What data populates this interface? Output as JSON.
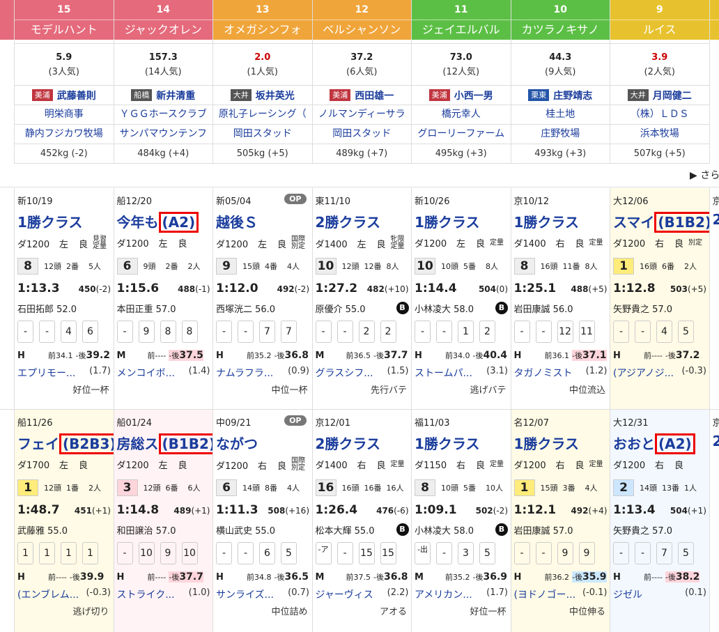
{
  "horses": [
    {
      "num": "15",
      "name": "モデルハント",
      "color": "#e56a7b",
      "odds": "5.9",
      "fav": "(3人気)",
      "top": false,
      "belong": "美浦",
      "bcolor": "#c0353f",
      "jockey": "武藤善則",
      "owner": "明栄商事",
      "breeder": "静内フジカワ牧場",
      "weight": "452kg (-2)"
    },
    {
      "num": "14",
      "name": "ジャックオレン",
      "color": "#e56a7b",
      "odds": "157.3",
      "fav": "(14人気)",
      "top": false,
      "belong": "船橋",
      "bcolor": "#555",
      "jockey": "新井清重",
      "owner": "ＹＧＧホースクラブ",
      "breeder": "サンパマウンテンフ",
      "weight": "484kg (+4)"
    },
    {
      "num": "13",
      "name": "オメガシンフォ",
      "color": "#f0a53a",
      "odds": "2.0",
      "fav": "(1人気)",
      "top": true,
      "belong": "大井",
      "bcolor": "#555",
      "jockey": "坂井英光",
      "owner": "原礼子レーシング（",
      "breeder": "岡田スタッド",
      "weight": "505kg (+5)"
    },
    {
      "num": "12",
      "name": "ベルシャンソン",
      "color": "#f0a53a",
      "odds": "37.2",
      "fav": "(6人気)",
      "top": false,
      "belong": "美浦",
      "bcolor": "#c0353f",
      "jockey": "西田雄一",
      "owner": "ノルマンディーサラ",
      "breeder": "岡田スタッド",
      "weight": "489kg (+7)"
    },
    {
      "num": "11",
      "name": "ジェイエルバル",
      "color": "#5cbf45",
      "odds": "73.0",
      "fav": "(12人気)",
      "top": false,
      "belong": "美浦",
      "bcolor": "#c0353f",
      "jockey": "小西一男",
      "owner": "橋元幸人",
      "breeder": "グローリーファーム",
      "weight": "495kg (+3)"
    },
    {
      "num": "10",
      "name": "カツラノキサノ",
      "color": "#5cbf45",
      "odds": "44.3",
      "fav": "(9人気)",
      "top": false,
      "belong": "栗東",
      "bcolor": "#2455a8",
      "jockey": "庄野靖志",
      "owner": "桂土地",
      "breeder": "庄野牧場",
      "weight": "493kg (+3)"
    },
    {
      "num": "9",
      "name": "ルイス",
      "color": "#e8c22e",
      "odds": "3.9",
      "fav": "(2人気)",
      "top": true,
      "belong": "大井",
      "bcolor": "#555",
      "jockey": "月岡健二",
      "owner": "（株）ＬＤＳ",
      "breeder": "浜本牧場",
      "weight": "507kg (+5)"
    }
  ],
  "more_link": "▶ さら",
  "race1": [
    {
      "bg": "",
      "date": "新10/19",
      "op": "",
      "pre": "",
      "tag": "",
      "title": "1勝クラス",
      "dist": "ダ1200",
      "dir": "左",
      "track": "良",
      "note": "見習\n定量",
      "rank": "8",
      "rcls": "",
      "heads": "12頭",
      "gate": "2番",
      "pop": "5人",
      "time": "1:13.3",
      "bw": "450",
      "bwd": "(-2)",
      "jockey": "石田拓郎 52.0",
      "blinker": false,
      "pass": [
        "-",
        "-",
        "4",
        "6"
      ],
      "pace": "H",
      "f3": "前34.1",
      "l3": "39.2",
      "l3c": "",
      "winner": "エプリモー...",
      "diff": "(1.7)",
      "comment": "好位一杯"
    },
    {
      "bg": "",
      "date": "船12/20",
      "op": "",
      "pre": "今年も",
      "tag": "(A2)",
      "title": "",
      "dist": "ダ1200",
      "dir": "左",
      "track": "良",
      "note": "",
      "rank": "6",
      "rcls": "",
      "heads": "9頭",
      "gate": "2番",
      "pop": "2人",
      "time": "1:15.6",
      "bw": "488",
      "bwd": "(-1)",
      "jockey": "本田正重 57.0",
      "blinker": false,
      "pass": [
        "-",
        "9",
        "8",
        "8"
      ],
      "pace": "M",
      "f3": "前----",
      "l3": "37.5",
      "l3c": "hp",
      "winner": "メンコイボ...",
      "diff": "(1.4)",
      "comment": ""
    },
    {
      "bg": "",
      "date": "新05/04",
      "op": "OP",
      "pre": "",
      "tag": "",
      "title": "越後Ｓ",
      "dist": "ダ1200",
      "dir": "左",
      "track": "良",
      "note": "国際\n別定",
      "rank": "9",
      "rcls": "",
      "heads": "15頭",
      "gate": "4番",
      "pop": "4人",
      "time": "1:12.0",
      "bw": "492",
      "bwd": "(-2)",
      "jockey": "西塚洸二 56.0",
      "blinker": false,
      "pass": [
        "-",
        "-",
        "7",
        "7"
      ],
      "pace": "H",
      "f3": "前35.2",
      "l3": "36.8",
      "l3c": "",
      "winner": "ナムラフラ...",
      "diff": "(0.9)",
      "comment": "中位一杯"
    },
    {
      "bg": "",
      "date": "東11/10",
      "op": "",
      "pre": "",
      "tag": "",
      "title": "2勝クラス",
      "dist": "ダ1400",
      "dir": "左",
      "track": "良",
      "note": "牝限\n定量",
      "rank": "10",
      "rcls": "",
      "heads": "12頭",
      "gate": "12番",
      "pop": "8人",
      "time": "1:27.2",
      "bw": "482",
      "bwd": "(+10)",
      "jockey": "原優介 55.0",
      "blinker": true,
      "pass": [
        "-",
        "-",
        "2",
        "2"
      ],
      "pace": "M",
      "f3": "前36.5",
      "l3": "37.7",
      "l3c": "",
      "winner": "グラスシフ...",
      "diff": "(1.5)",
      "comment": "先行バテ"
    },
    {
      "bg": "",
      "date": "新10/26",
      "op": "",
      "pre": "",
      "tag": "",
      "title": "1勝クラス",
      "dist": "ダ1200",
      "dir": "左",
      "track": "良",
      "note": "定量",
      "rank": "10",
      "rcls": "",
      "heads": "10頭",
      "gate": "5番",
      "pop": "8人",
      "time": "1:14.4",
      "bw": "504",
      "bwd": "(0)",
      "jockey": "小林凌大 58.0",
      "blinker": true,
      "pass": [
        "-",
        "-",
        "1",
        "2"
      ],
      "pace": "H",
      "f3": "前34.0",
      "l3": "40.4",
      "l3c": "",
      "winner": "ストームパ...",
      "diff": "(3.1)",
      "comment": "逃げバテ"
    },
    {
      "bg": "",
      "date": "京10/12",
      "op": "",
      "pre": "",
      "tag": "",
      "title": "1勝クラス",
      "dist": "ダ1400",
      "dir": "右",
      "track": "良",
      "note": "定量",
      "rank": "8",
      "rcls": "",
      "heads": "16頭",
      "gate": "11番",
      "pop": "8人",
      "time": "1:25.1",
      "bw": "488",
      "bwd": "(+5)",
      "jockey": "岩田康誠 56.0",
      "blinker": false,
      "pass": [
        "-",
        "-",
        "12",
        "11"
      ],
      "pace": "H",
      "f3": "前36.1",
      "l3": "37.1",
      "l3c": "hp",
      "winner": "タガノミスト",
      "diff": "(1.2)",
      "comment": "中位流込"
    },
    {
      "bg": "hl",
      "date": "大12/06",
      "op": "",
      "pre": "スマイ",
      "tag": "(B1B2)",
      "title": "",
      "dist": "ダ1200",
      "dir": "右",
      "track": "良",
      "note": "別定",
      "rank": "1",
      "rcls": "w",
      "heads": "16頭",
      "gate": "6番",
      "pop": "2人",
      "time": "1:12.8",
      "bw": "503",
      "bwd": "(+5)",
      "jockey": "矢野貴之 57.0",
      "blinker": false,
      "pass": [
        "-",
        "-",
        "4",
        "5"
      ],
      "pace": "H",
      "f3": "前----",
      "l3": "37.2",
      "l3c": "",
      "winner": "(アジアノジ...",
      "diff": "(-0.3)",
      "comment": ""
    }
  ],
  "race2": [
    {
      "bg": "hl",
      "date": "船11/26",
      "op": "",
      "pre": "フェイ",
      "tag": "(B2B3)",
      "title": "",
      "dist": "ダ1700",
      "dir": "左",
      "track": "良",
      "note": "",
      "rank": "1",
      "rcls": "w",
      "heads": "12頭",
      "gate": "1番",
      "pop": "2人",
      "time": "1:48.7",
      "bw": "451",
      "bwd": "(+1)",
      "jockey": "武藤雅 55.0",
      "blinker": false,
      "pass": [
        "1",
        "1",
        "1",
        "1"
      ],
      "pace": "H",
      "f3": "前----",
      "l3": "39.9",
      "l3c": "",
      "winner": "(エンブレム...",
      "diff": "(-0.3)",
      "comment": "逃げ切り"
    },
    {
      "bg": "pink",
      "date": "船01/24",
      "op": "",
      "pre": "房総ス",
      "tag": "(B1B2)",
      "title": "",
      "dist": "ダ1200",
      "dir": "左",
      "track": "良",
      "note": "",
      "rank": "3",
      "rcls": "s",
      "heads": "12頭",
      "gate": "6番",
      "pop": "6人",
      "time": "1:14.8",
      "bw": "489",
      "bwd": "(+1)",
      "jockey": "和田譲治 57.0",
      "blinker": false,
      "pass": [
        "-",
        "10",
        "9",
        "10"
      ],
      "pace": "H",
      "f3": "前----",
      "l3": "37.7",
      "l3c": "hp",
      "winner": "ストライク...",
      "diff": "(1.0)",
      "comment": ""
    },
    {
      "bg": "",
      "date": "中09/21",
      "op": "OP",
      "pre": "",
      "tag": "",
      "title": "ながつ",
      "dist": "ダ1200",
      "dir": "右",
      "track": "良",
      "note": "国際\n別定",
      "rank": "6",
      "rcls": "",
      "heads": "14頭",
      "gate": "8番",
      "pop": "4人",
      "time": "1:11.3",
      "bw": "508",
      "bwd": "(+16)",
      "jockey": "横山武史 55.0",
      "blinker": false,
      "pass": [
        "-",
        "-",
        "6",
        "5"
      ],
      "pace": "H",
      "f3": "前34.8",
      "l3": "36.5",
      "l3c": "",
      "winner": "サンライズ...",
      "diff": "(0.7)",
      "comment": "中位詰め"
    },
    {
      "bg": "",
      "date": "京12/01",
      "op": "",
      "pre": "",
      "tag": "",
      "title": "2勝クラス",
      "dist": "ダ1400",
      "dir": "右",
      "track": "良",
      "note": "定量",
      "rank": "16",
      "rcls": "",
      "heads": "16頭",
      "gate": "16番",
      "pop": "16人",
      "time": "1:26.4",
      "bw": "476",
      "bwd": "(-6)",
      "jockey": "松本大輝 55.0",
      "blinker": true,
      "pass": [
        "-ア",
        "-",
        "15",
        "15"
      ],
      "pace": "M",
      "f3": "前37.5",
      "l3": "36.8",
      "l3c": "",
      "winner": "ジャーヴィス",
      "diff": "(2.2)",
      "comment": "アオる"
    },
    {
      "bg": "",
      "date": "福11/03",
      "op": "",
      "pre": "",
      "tag": "",
      "title": "1勝クラス",
      "dist": "ダ1150",
      "dir": "右",
      "track": "良",
      "note": "定量",
      "rank": "8",
      "rcls": "",
      "heads": "10頭",
      "gate": "5番",
      "pop": "10人",
      "time": "1:09.1",
      "bw": "502",
      "bwd": "(-2)",
      "jockey": "小林凌大 58.0",
      "blinker": true,
      "pass": [
        "-出",
        "-",
        "3",
        "5"
      ],
      "pace": "M",
      "f3": "前35.2",
      "l3": "36.9",
      "l3c": "",
      "winner": "アメリカン...",
      "diff": "(1.7)",
      "comment": "好位一杯"
    },
    {
      "bg": "hl",
      "date": "名12/07",
      "op": "",
      "pre": "",
      "tag": "",
      "title": "1勝クラス",
      "dist": "ダ1200",
      "dir": "右",
      "track": "良",
      "note": "定量",
      "rank": "1",
      "rcls": "w",
      "heads": "15頭",
      "gate": "3番",
      "pop": "4人",
      "time": "1:12.1",
      "bw": "492",
      "bwd": "(+4)",
      "jockey": "岩田康誠 57.0",
      "blinker": false,
      "pass": [
        "-",
        "-",
        "9",
        "9"
      ],
      "pace": "H",
      "f3": "前36.2",
      "l3": "35.9",
      "l3c": "hb",
      "winner": "(ヨドノゴー...",
      "diff": "(-0.1)",
      "comment": "中位伸る"
    },
    {
      "bg": "blue",
      "date": "大12/31",
      "op": "",
      "pre": "おおと",
      "tag": "(A2)",
      "title": "",
      "dist": "ダ1200",
      "dir": "右",
      "track": "良",
      "note": "",
      "rank": "2",
      "rcls": "t",
      "heads": "14頭",
      "gate": "13番",
      "pop": "1人",
      "time": "1:13.4",
      "bw": "504",
      "bwd": "(+1)",
      "jockey": "矢野貴之 57.0",
      "blinker": false,
      "pass": [
        "-",
        "-",
        "7",
        "5"
      ],
      "pace": "H",
      "f3": "前----",
      "l3": "38.2",
      "l3c": "hp",
      "winner": "ジゼル",
      "diff": "(0.1)",
      "comment": ""
    }
  ],
  "partial": {
    "r1_date": "京",
    "r2_date": "京",
    "r1_title": "2",
    "r2_title": "2"
  }
}
